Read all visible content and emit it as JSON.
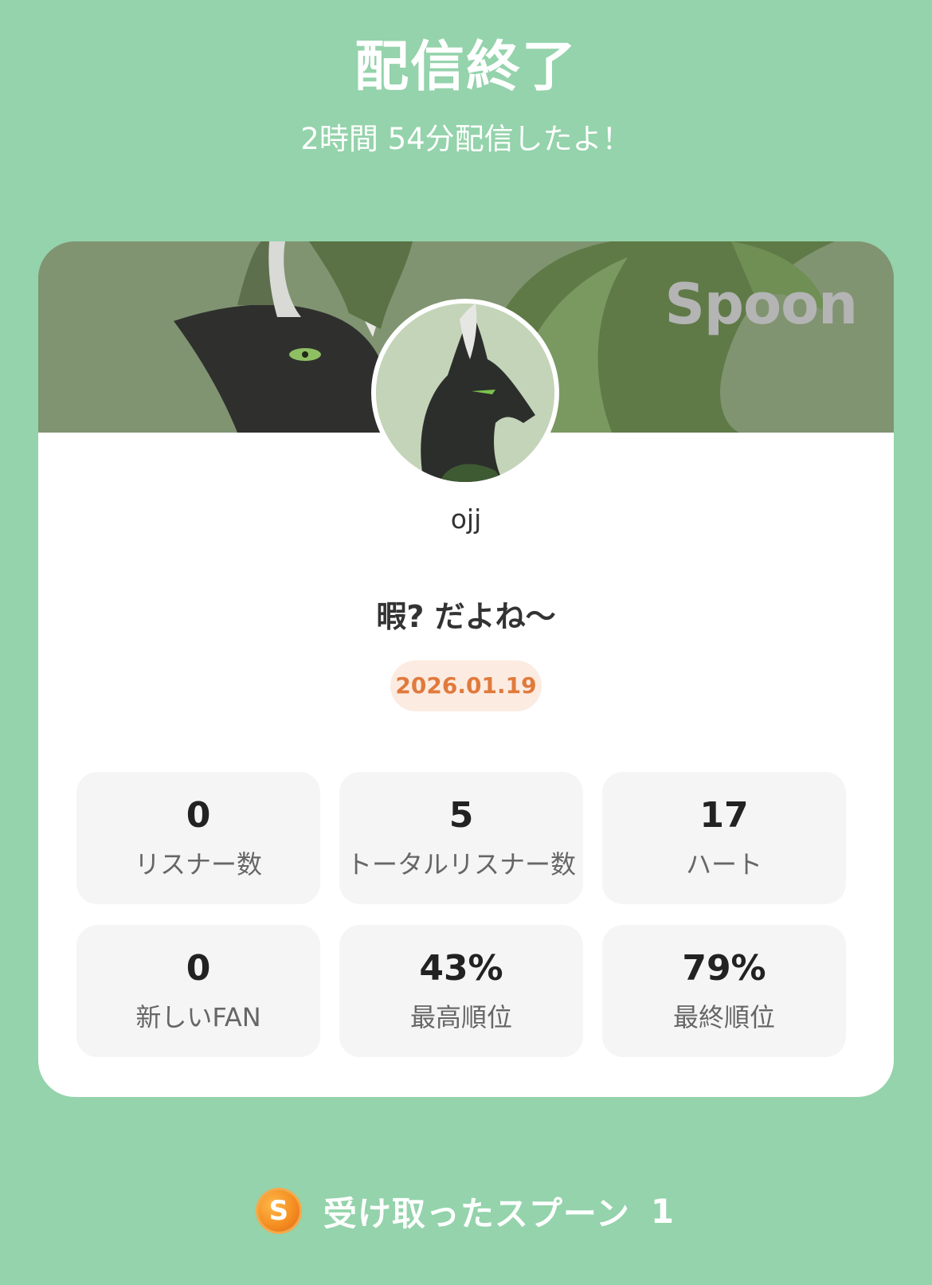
{
  "header": {
    "title": "配信終了",
    "subtitle": "2時間 54分配信したよ！"
  },
  "card": {
    "brand": "Spoon",
    "username": "ojj",
    "stream_title": "暇? だよね〜",
    "date": "2026.01.19"
  },
  "stats": [
    {
      "value": "0",
      "label": "リスナー数"
    },
    {
      "value": "5",
      "label": "トータルリスナー数"
    },
    {
      "value": "17",
      "label": "ハート"
    },
    {
      "value": "0",
      "label": "新しいFAN"
    },
    {
      "value": "43%",
      "label": "最高順位"
    },
    {
      "value": "79%",
      "label": "最終順位"
    }
  ],
  "footer": {
    "spoon_icon_letter": "S",
    "spoon_label": "受け取ったスプーン",
    "spoon_count": "1"
  },
  "colors": {
    "background": "#94d3ab",
    "card": "#ffffff",
    "banner": "#809471",
    "date_text": "#e07a3c",
    "date_badge": "#fcebe1",
    "stat_tile": "#f5f5f5"
  },
  "icons": {
    "banner_art": "wolf-character-banner",
    "avatar": "wolf-character-avatar",
    "spoon": "spoon-coin-icon"
  }
}
